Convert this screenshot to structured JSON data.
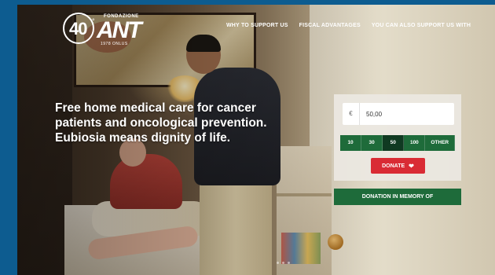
{
  "logo": {
    "number": "40",
    "degree": "°",
    "foundation": "FONDAZIONE",
    "name": "ANT",
    "onlus": "1978 ONLUS",
    "tagline": "ITALIA ONLUS"
  },
  "nav": {
    "items": [
      {
        "label": "WHY TO SUPPORT US"
      },
      {
        "label": "FISCAL ADVANTAGES"
      },
      {
        "label": "YOU CAN ALSO SUPPORT US WITH"
      }
    ]
  },
  "hero": {
    "headline_lines": [
      "Free home medical care for cancer",
      "patients and oncological prevention.",
      "Eubiosia means dignity of life."
    ]
  },
  "donation": {
    "currency": "€",
    "amount_value": "50,00",
    "amounts": [
      {
        "label": "10"
      },
      {
        "label": "30"
      },
      {
        "label": "50",
        "selected": true
      },
      {
        "label": "100"
      },
      {
        "label": "OTHER"
      }
    ],
    "donate_label": "DONATE",
    "donate_icon": "heart-icon",
    "memory_label": "DONATION IN MEMORY OF"
  },
  "colors": {
    "brand_green": "#1e6b3a",
    "brand_green_selected": "#103a22",
    "donate_red": "#d92b34",
    "frame_blue": "#0d5c90"
  }
}
